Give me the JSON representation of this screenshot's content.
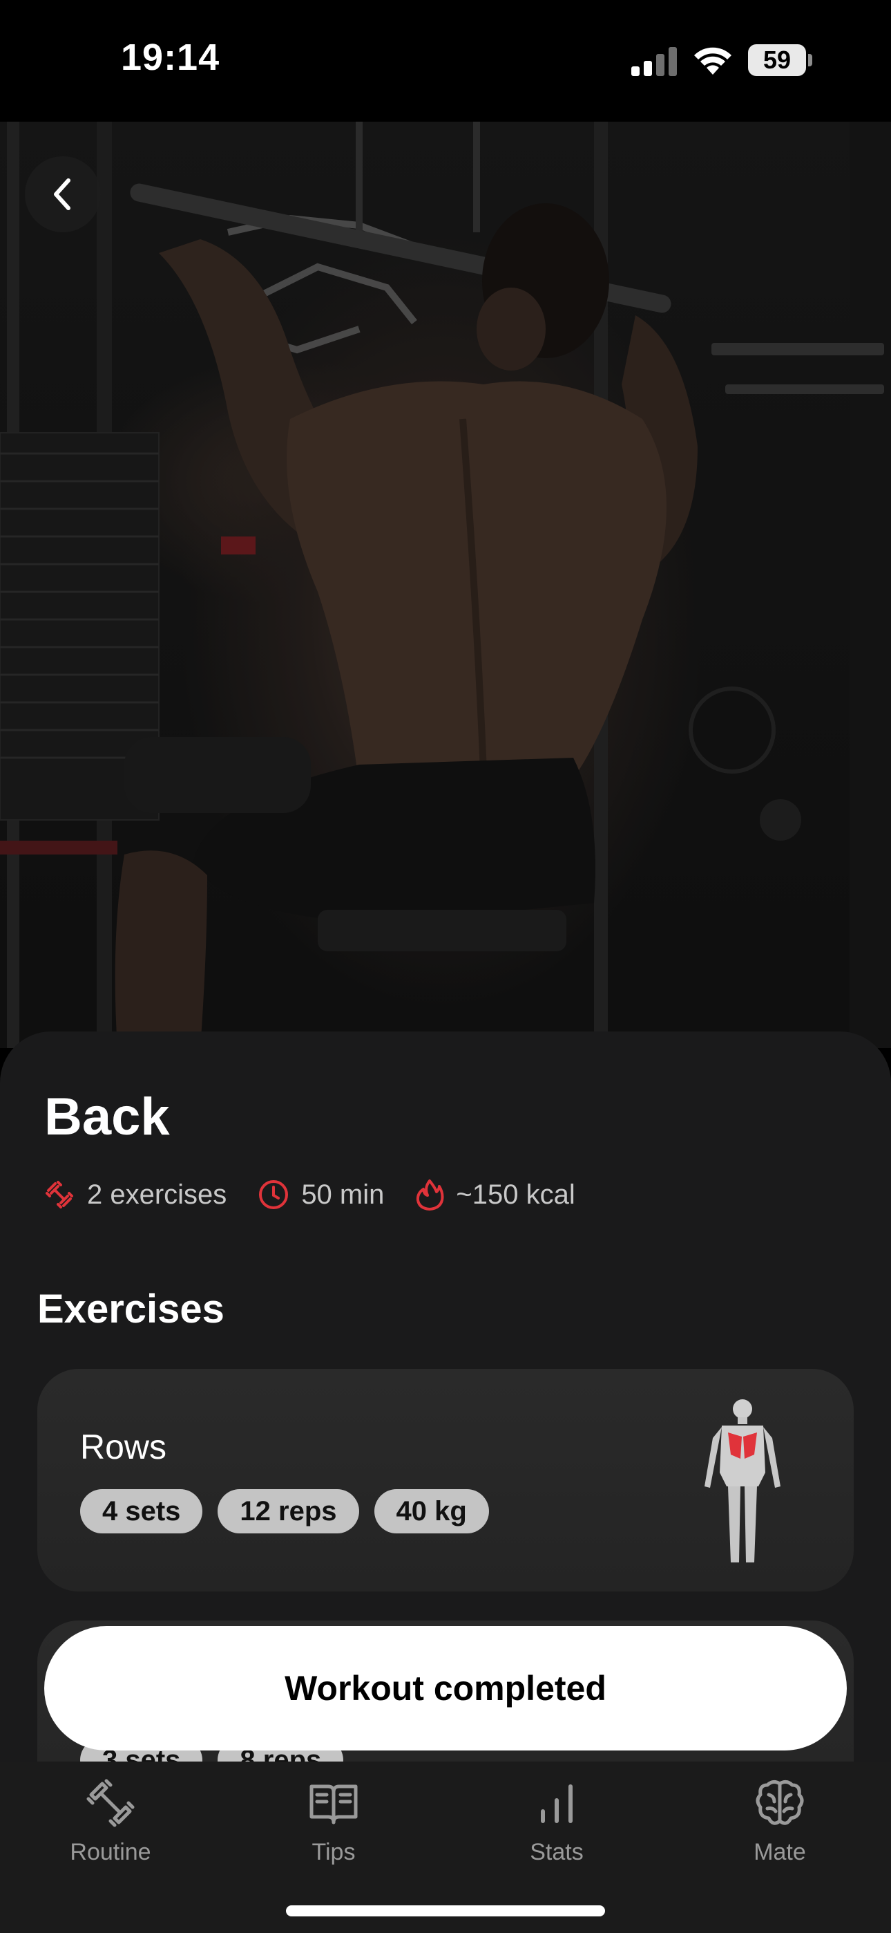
{
  "status_bar": {
    "time": "19:14",
    "battery": "59"
  },
  "workout": {
    "title": "Back",
    "meta": {
      "exercises": "2 exercises",
      "duration": "50 min",
      "calories": "~150 kcal"
    },
    "accent_color": "#e0333a"
  },
  "exercises": {
    "section_title": "Exercises",
    "items": [
      {
        "name": "Rows",
        "chips": [
          "4 sets",
          "12 reps",
          "40 kg"
        ]
      },
      {
        "name": "",
        "chips": [
          "3 sets",
          "8 reps"
        ]
      }
    ]
  },
  "cta": {
    "label": "Workout completed"
  },
  "tabs": [
    {
      "label": "Routine",
      "icon": "dumbbell-icon"
    },
    {
      "label": "Tips",
      "icon": "book-icon"
    },
    {
      "label": "Stats",
      "icon": "bar-chart-icon"
    },
    {
      "label": "Mate",
      "icon": "brain-icon"
    }
  ]
}
